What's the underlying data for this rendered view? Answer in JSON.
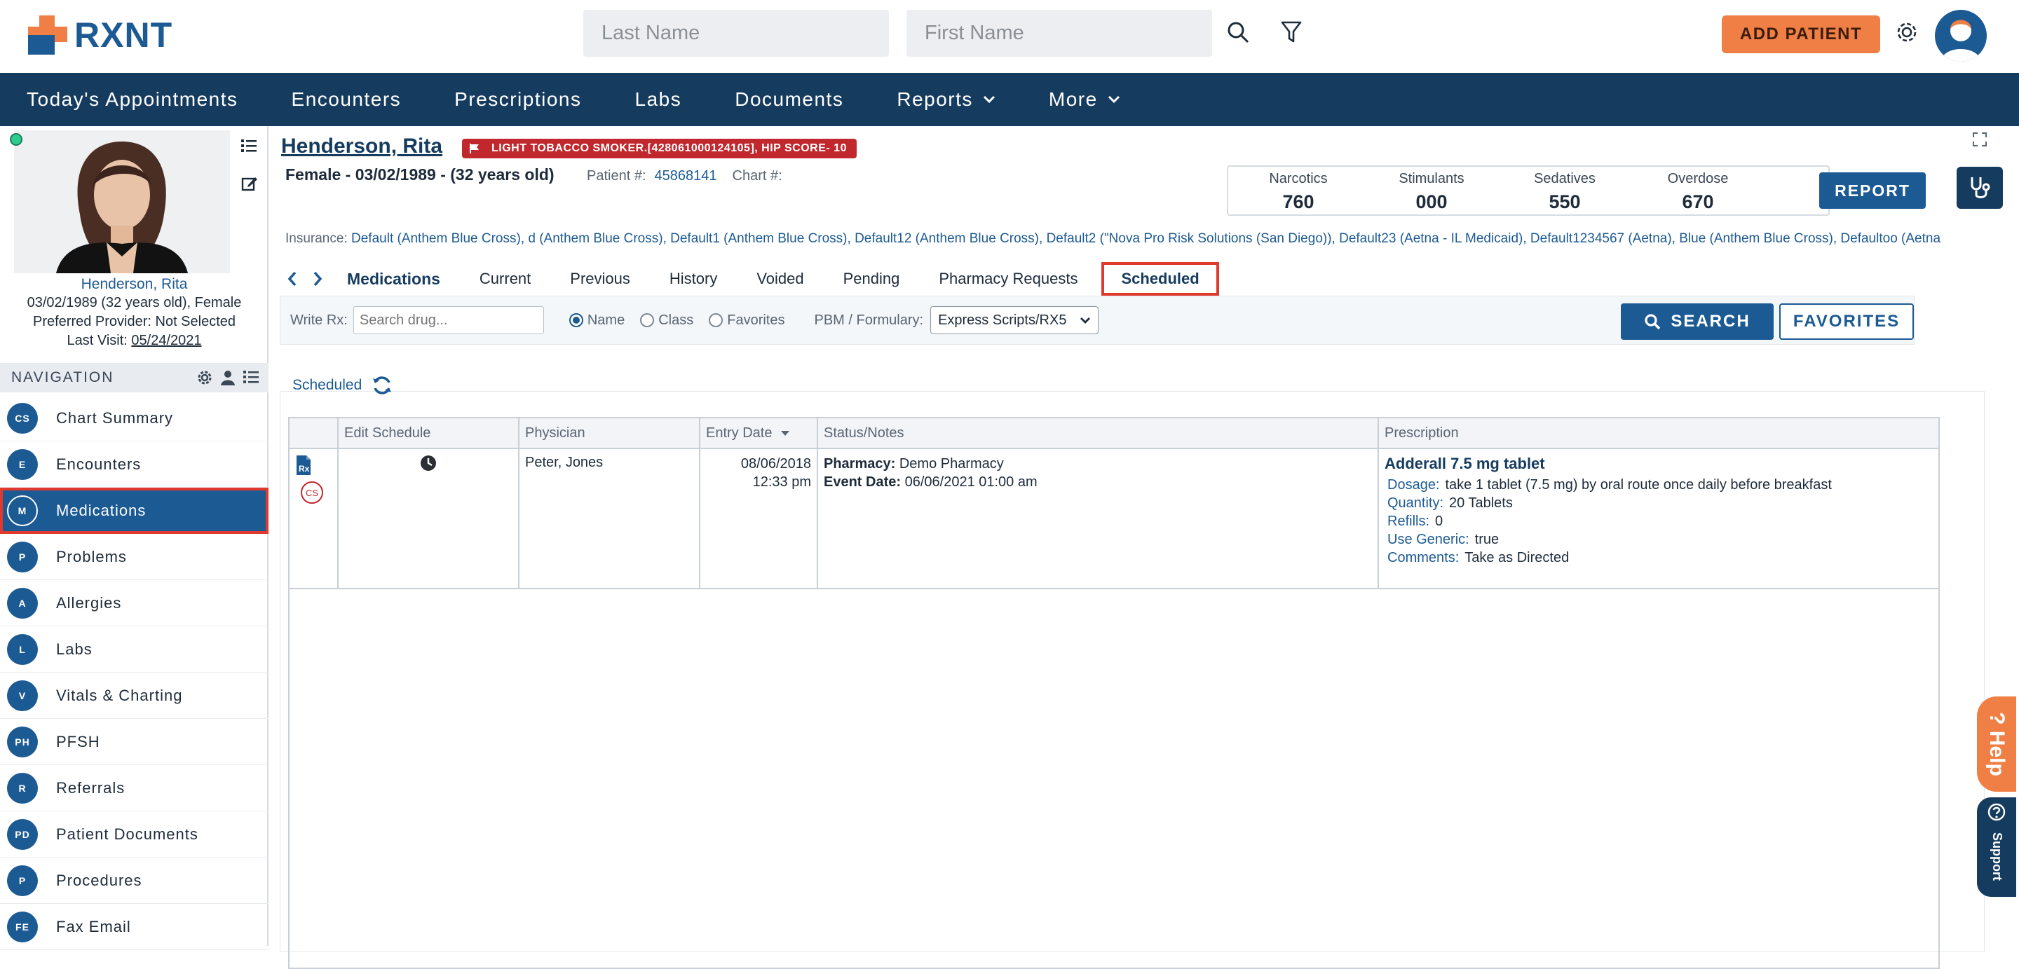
{
  "brand": {
    "name": "RXNT",
    "accent": "#ef7f45",
    "primary": "#1c5a93",
    "nav_bg": "#153b5e"
  },
  "header": {
    "last_name_placeholder": "Last Name",
    "first_name_placeholder": "First Name",
    "add_patient_label": "ADD PATIENT"
  },
  "topnav": {
    "items": [
      "Today's Appointments",
      "Encounters",
      "Prescriptions",
      "Labs",
      "Documents",
      "Reports",
      "More"
    ]
  },
  "patient_card": {
    "name": "Henderson, Rita",
    "dob_line": "03/02/1989 (32 years old), Female",
    "provider_line": "Preferred Provider: Not Selected",
    "last_visit_label": "Last Visit:",
    "last_visit": "05/24/2021"
  },
  "navigation": {
    "header": "NAVIGATION",
    "items": [
      {
        "badge": "CS",
        "label": "Chart Summary"
      },
      {
        "badge": "E",
        "label": "Encounters"
      },
      {
        "badge": "M",
        "label": "Medications"
      },
      {
        "badge": "P",
        "label": "Problems"
      },
      {
        "badge": "A",
        "label": "Allergies"
      },
      {
        "badge": "L",
        "label": "Labs"
      },
      {
        "badge": "V",
        "label": "Vitals & Charting"
      },
      {
        "badge": "PH",
        "label": "PFSH"
      },
      {
        "badge": "R",
        "label": "Referrals"
      },
      {
        "badge": "PD",
        "label": "Patient Documents"
      },
      {
        "badge": "P",
        "label": "Procedures"
      },
      {
        "badge": "FE",
        "label": "Fax Email"
      }
    ]
  },
  "patient_header": {
    "name": "Henderson, Rita",
    "alert": "LIGHT TOBACCO SMOKER.[428061000124105], HIP SCORE- 10",
    "demographics": "Female - 03/02/1989 - (32 years old)",
    "patient_num_label": "Patient #:",
    "patient_num": "45868141",
    "chart_num_label": "Chart #:"
  },
  "pdmp": {
    "narcotics_label": "Narcotics",
    "narcotics": "760",
    "stimulants_label": "Stimulants",
    "stimulants": "000",
    "sedatives_label": "Sedatives",
    "sedatives": "550",
    "overdose_label": "Overdose",
    "overdose": "670",
    "report_label": "REPORT"
  },
  "insurance": {
    "label": "Insurance:",
    "text": "Default (Anthem Blue Cross), d (Anthem Blue Cross), Default1 (Anthem Blue Cross), Default12 (Anthem Blue Cross), Default2 (\"Nova Pro Risk Solutions (San Diego)), Default23 (Aetna - IL Medicaid), Default1234567 (Aetna), Blue (Anthem Blue Cross), Defaultoo (Aetna"
  },
  "med_tabs": {
    "title": "Medications",
    "items": [
      "Current",
      "Previous",
      "History",
      "Voided",
      "Pending",
      "Pharmacy Requests"
    ],
    "active": "Scheduled"
  },
  "write_rx": {
    "label": "Write Rx:",
    "placeholder": "Search drug...",
    "radio_name": "Name",
    "radio_class": "Class",
    "radio_favorites": "Favorites",
    "pbm_label": "PBM / Formulary:",
    "pbm_value": "Express Scripts/RX5",
    "search_label": "SEARCH",
    "favorites_label": "FAVORITES"
  },
  "scheduled": {
    "label": "Scheduled",
    "columns": [
      "Edit Schedule",
      "Physician",
      "Entry Date",
      "Status/Notes",
      "Prescription"
    ],
    "rows": [
      {
        "physician": "Peter, Jones",
        "entry_date": "08/06/2018",
        "entry_time": "12:33 pm",
        "pharmacy_label": "Pharmacy:",
        "pharmacy": "Demo Pharmacy",
        "event_label": "Event Date:",
        "event_date": "06/06/2021 01:00 am",
        "drug": "Adderall 7.5 mg tablet",
        "dosage_label": "Dosage:",
        "dosage": "take 1 tablet (7.5 mg) by oral route once daily before breakfast",
        "quantity_label": "Quantity:",
        "quantity": "20 Tablets",
        "refills_label": "Refills:",
        "refills": "0",
        "generic_label": "Use Generic:",
        "generic": "true",
        "comments_label": "Comments:",
        "comments": "Take as Directed",
        "cs_badge": "CS"
      }
    ]
  },
  "help": {
    "label": "Help"
  },
  "support": {
    "label": "Support"
  }
}
